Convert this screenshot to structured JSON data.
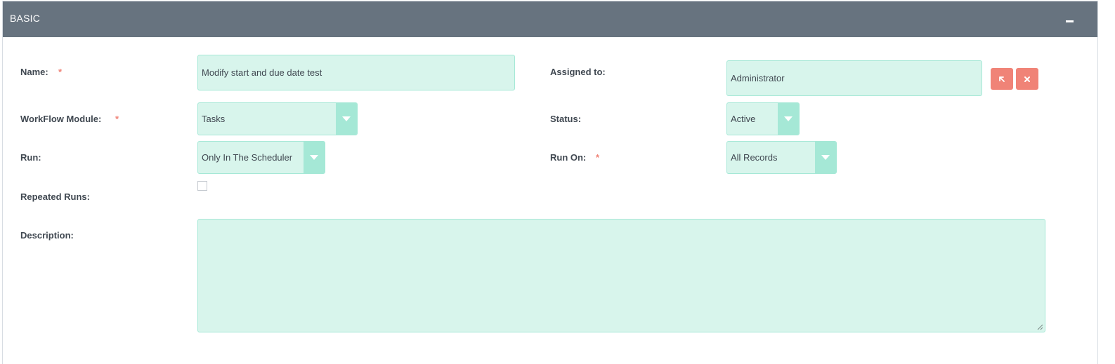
{
  "panel": {
    "title": "BASIC"
  },
  "form": {
    "name": {
      "label": "Name:",
      "required_mark": "*",
      "value": "Modify start and due date test"
    },
    "assigned_to": {
      "label": "Assigned to:",
      "value": "Administrator",
      "select_icon": "arrow-select-icon",
      "clear_icon": "clear-x-icon"
    },
    "workflow_module": {
      "label": "WorkFlow Module:",
      "required_mark": "*",
      "value": "Tasks"
    },
    "status": {
      "label": "Status:",
      "value": "Active"
    },
    "run": {
      "label": "Run:",
      "value": "Only In The Scheduler"
    },
    "run_on": {
      "label": "Run On:",
      "required_mark": "*",
      "value": "All Records"
    },
    "repeated_runs": {
      "label": "Repeated Runs:",
      "checked": false
    },
    "description": {
      "label": "Description:",
      "value": ""
    }
  },
  "colors": {
    "header_bg": "#67737f",
    "field_bg": "#d8f5ec",
    "field_border": "#a5e8d6",
    "button_red": "#f08377",
    "required_mark": "#f08377",
    "label_text": "#404851"
  }
}
